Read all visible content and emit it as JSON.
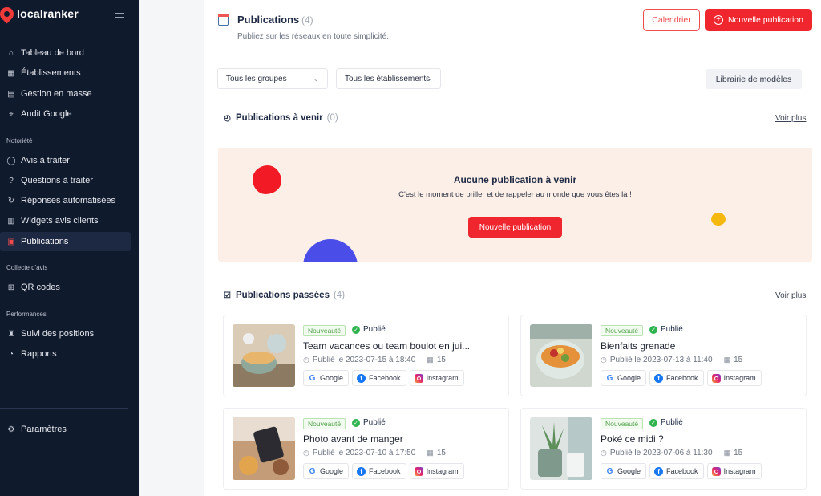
{
  "brand": {
    "name": "localranker"
  },
  "sidebar": {
    "items_top": [
      {
        "label": "Tableau de bord",
        "icon": "home-icon"
      },
      {
        "label": "Établissements",
        "icon": "building-icon"
      },
      {
        "label": "Gestion en masse",
        "icon": "document-icon"
      },
      {
        "label": "Audit Google",
        "icon": "telescope-icon"
      }
    ],
    "section_notoriete": "Notoriété",
    "items_notoriete": [
      {
        "label": "Avis à traiter",
        "icon": "chat-icon"
      },
      {
        "label": "Questions à traiter",
        "icon": "question-chat-icon"
      },
      {
        "label": "Réponses automatisées",
        "icon": "auto-reply-icon"
      },
      {
        "label": "Widgets avis clients",
        "icon": "widget-icon"
      },
      {
        "label": "Publications",
        "icon": "calendar-icon"
      }
    ],
    "section_collecte": "Collecte d'avis",
    "items_collecte": [
      {
        "label": "QR codes",
        "icon": "qr-icon"
      }
    ],
    "section_performances": "Performances",
    "items_performances": [
      {
        "label": "Suivi des positions",
        "icon": "trophy-icon"
      },
      {
        "label": "Rapports",
        "icon": "chart-icon"
      }
    ],
    "settings": {
      "label": "Paramètres",
      "icon": "gear-icon"
    }
  },
  "header": {
    "title": "Publications",
    "count": "(4)",
    "subtitle": "Publiez sur les réseaux en toute simplicité.",
    "calendar_button": "Calendrier",
    "new_button": "Nouvelle publication"
  },
  "filters": {
    "groups": "Tous les groupes",
    "establishments": "Tous les établissements",
    "library_button": "Librairie de modèles"
  },
  "upcoming": {
    "title": "Publications à venir",
    "count": "(0)",
    "see_more": "Voir plus",
    "empty_title": "Aucune publication à venir",
    "empty_text": "C'est le moment de briller et de rappeler au monde que vous êtes là !",
    "empty_button": "Nouvelle publication"
  },
  "past": {
    "title": "Publications passées",
    "count": "(4)",
    "see_more": "Voir plus",
    "cards": [
      {
        "badge": "Nouveauté",
        "status": "Publié",
        "title": "Team vacances ou team boulot en jui...",
        "date": "Publié le 2023-07-15 à 18:40",
        "count": "15",
        "networks": [
          "Google",
          "Facebook",
          "Instagram"
        ]
      },
      {
        "badge": "Nouveauté",
        "status": "Publié",
        "title": "Bienfaits grenade",
        "date": "Publié le 2023-07-13 à 11:40",
        "count": "15",
        "networks": [
          "Google",
          "Facebook",
          "Instagram"
        ]
      },
      {
        "badge": "Nouveauté",
        "status": "Publié",
        "title": "Photo avant de manger",
        "date": "Publié le 2023-07-10 à 17:50",
        "count": "15",
        "networks": [
          "Google",
          "Facebook",
          "Instagram"
        ]
      },
      {
        "badge": "Nouveauté",
        "status": "Publié",
        "title": "Poké ce midi ?",
        "date": "Publié le 2023-07-06 à 11:30",
        "count": "15",
        "networks": [
          "Google",
          "Facebook",
          "Instagram"
        ]
      }
    ]
  },
  "colors": {
    "accent": "#f0262f",
    "sidebar": "#101a2d",
    "success": "#2fb34f"
  }
}
